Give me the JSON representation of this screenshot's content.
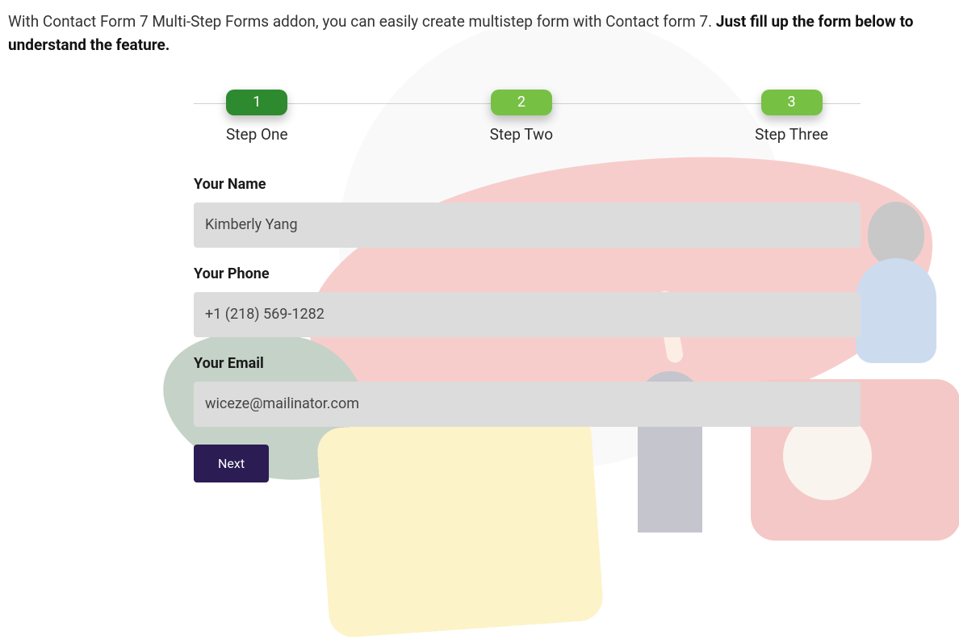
{
  "intro": {
    "text_normal": "With Contact Form 7 Multi-Step Forms addon, you can easily create multistep form with Contact form 7. ",
    "text_bold": "Just fill up the form below to understand the feature."
  },
  "steps": [
    {
      "number": "1",
      "label": "Step One",
      "active": true
    },
    {
      "number": "2",
      "label": "Step Two",
      "active": false
    },
    {
      "number": "3",
      "label": "Step Three",
      "active": false
    }
  ],
  "fields": {
    "name": {
      "label": "Your Name",
      "value": "Kimberly Yang"
    },
    "phone": {
      "label": "Your Phone",
      "value": "+1 (218) 569-1282"
    },
    "email": {
      "label": "Your Email",
      "value": "wiceze@mailinator.com"
    }
  },
  "buttons": {
    "next": "Next"
  }
}
